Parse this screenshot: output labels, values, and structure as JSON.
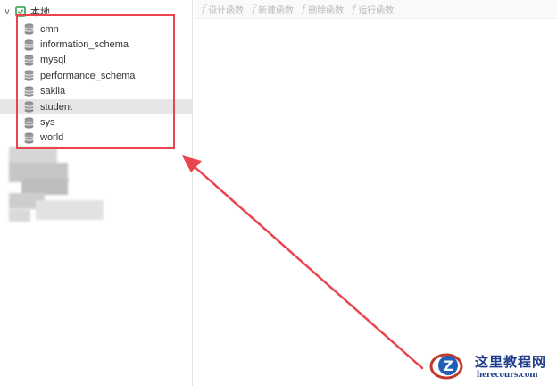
{
  "navigator": {
    "connection": {
      "label": "本地",
      "expanded": true,
      "icon": "connection-icon"
    },
    "databases": [
      {
        "label": "cmn",
        "icon": "database-icon",
        "selected": false
      },
      {
        "label": "information_schema",
        "icon": "database-icon",
        "selected": false
      },
      {
        "label": "mysql",
        "icon": "database-icon",
        "selected": false
      },
      {
        "label": "performance_schema",
        "icon": "database-icon",
        "selected": false
      },
      {
        "label": "sakila",
        "icon": "database-icon",
        "selected": false
      },
      {
        "label": "student",
        "icon": "database-icon",
        "selected": true
      },
      {
        "label": "sys",
        "icon": "database-icon",
        "selected": false
      },
      {
        "label": "world",
        "icon": "database-icon",
        "selected": false
      }
    ]
  },
  "toolbar": {
    "design_function": "设计函数",
    "new_function": "新建函数",
    "delete_function": "删除函数",
    "run_function": "运行函数"
  },
  "annotation": {
    "highlight_color": "#e8454f",
    "arrow_color": "#e8454f"
  },
  "watermark": {
    "title": "这里教程网",
    "url": "herecours.com",
    "color": "#1f3c8c"
  }
}
